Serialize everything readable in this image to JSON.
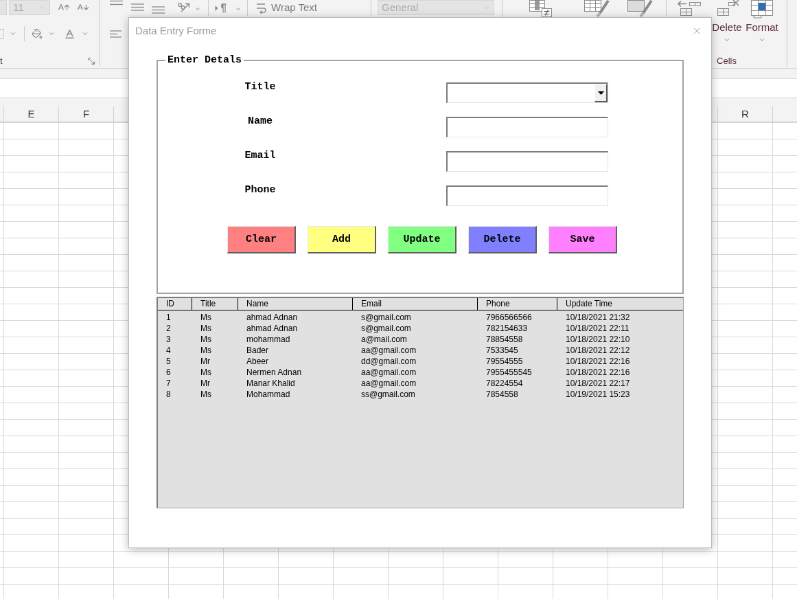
{
  "ribbon": {
    "font_size": {
      "value": "11",
      "disabled": true
    },
    "font_group_label": "t",
    "wrap_text": "Wrap Text",
    "number_format": {
      "value": "General",
      "disabled": true
    },
    "cells_commands": [
      "Delete",
      "Format"
    ],
    "cells_group_label": "Cells"
  },
  "sheet": {
    "columns_left": [
      "E",
      "F"
    ],
    "columns_right": [
      "R"
    ]
  },
  "dialog": {
    "title": "Data Entry Forme",
    "frame": {
      "legend": "Enter Detals",
      "fields": [
        {
          "label": "Title",
          "kind": "combo"
        },
        {
          "label": "Name",
          "kind": "text"
        },
        {
          "label": "Email",
          "kind": "text"
        },
        {
          "label": "Phone",
          "kind": "text"
        }
      ],
      "buttons": [
        {
          "label": "Clear",
          "color": "#ff8080"
        },
        {
          "label": "Add",
          "color": "#ffff80"
        },
        {
          "label": "Update",
          "color": "#80ff80"
        },
        {
          "label": "Delete",
          "color": "#8080ff"
        },
        {
          "label": "Save",
          "color": "#ff80ff"
        }
      ]
    },
    "list": {
      "columns": [
        "ID",
        "Title",
        "Name",
        "Email",
        "Phone",
        "Update Time"
      ],
      "rows": [
        [
          "1",
          "Ms",
          "ahmad Adnan",
          "s@gmail.com",
          "7966566566",
          "10/18/2021 21:32"
        ],
        [
          "2",
          "Ms",
          "ahmad Adnan",
          "s@gmail.com",
          "782154633",
          "10/18/2021 22:11"
        ],
        [
          "3",
          "Ms",
          "mohammad",
          "a@mail.com",
          "78854558",
          "10/18/2021 22:10"
        ],
        [
          "4",
          "Ms",
          "Bader",
          "aa@gmail.com",
          "7533545",
          "10/18/2021 22:12"
        ],
        [
          "5",
          "Mr",
          "Abeer",
          "dd@gmail.com",
          "79554555",
          "10/18/2021 22:16"
        ],
        [
          "6",
          "Ms",
          "Nermen Adnan",
          "aa@gmail.com",
          "7955455545",
          "10/18/2021 22:16"
        ],
        [
          "7",
          "Mr",
          "Manar Khalid",
          "aa@gmail.com",
          "78224554",
          "10/18/2021 22:17"
        ],
        [
          "8",
          "Ms",
          "Mohammad",
          "ss@gmail.com",
          "7854558",
          "10/19/2021 15:23"
        ]
      ]
    }
  }
}
